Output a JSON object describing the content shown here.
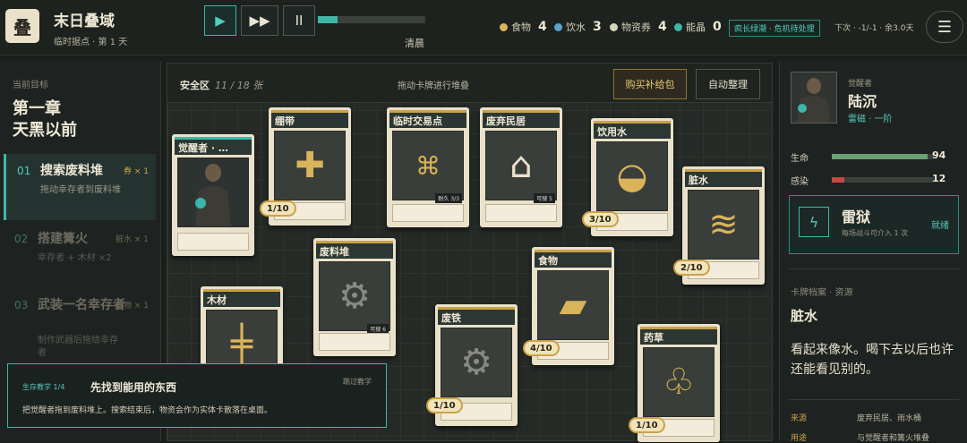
{
  "header": {
    "logo_glyph": "叠",
    "title": "末日叠域",
    "subtitle": "临时据点 · 第 1 天",
    "controls": {
      "play": "▶",
      "fast": "▶▶",
      "pause": "II"
    },
    "time_progress": 0.18,
    "time_of_day": "清晨",
    "resources": [
      {
        "label": "食物",
        "value": "4",
        "color": "#d9b45a"
      },
      {
        "label": "饮水",
        "value": "3",
        "color": "#5aa3c9"
      },
      {
        "label": "物资券",
        "value": "4",
        "color": "#d8d2c0"
      },
      {
        "label": "能晶",
        "value": "0",
        "color": "#3fb7a6"
      }
    ],
    "alert": "疯长绿潮 · 危机待处理",
    "next_event": "下次 · -1/-1 · 余3.0天",
    "menu_icon": "☰"
  },
  "left": {
    "heading": "当前目标",
    "chapter_line1": "第一章",
    "chapter_line2": "天黑以前",
    "tasks": [
      {
        "num": "01",
        "name": "搜索废料堆",
        "desc": "拖动幸存者到废料堆",
        "req": "券 × 1"
      },
      {
        "num": "02",
        "name": "搭建篝火",
        "desc": "幸存者 + 木材 ×2",
        "req": "脏水 × 1"
      },
      {
        "num": "03",
        "name": "武装一名幸存者",
        "desc": "制作武器后拖给幸存者",
        "req": "食物 × 1"
      }
    ]
  },
  "board": {
    "zone": "安全区",
    "count": "11 / 18 张",
    "hint": "拖动卡牌进行堆叠",
    "buy_label": "购买补给包",
    "sort_label": "自动整理",
    "cards": {
      "survivor": {
        "title": "觉醒者 · …"
      },
      "bandage": {
        "title": "绷带",
        "badge": "1/10",
        "icon": "✚"
      },
      "trade": {
        "title": "临时交易点",
        "icon": "⌘",
        "tag": "耐久 3/3"
      },
      "house": {
        "title": "废弃民居",
        "icon": "⌂",
        "tag": "可搜 5"
      },
      "water": {
        "title": "饮用水",
        "badge": "3/10",
        "icon": "◒"
      },
      "dirty": {
        "title": "脏水",
        "badge": "2/10",
        "icon": "≋"
      },
      "scrap": {
        "title": "废料堆",
        "icon": "⚙",
        "tag": "可搜 6"
      },
      "wood": {
        "title": "木材",
        "badge": "1/10",
        "icon": "╪"
      },
      "food": {
        "title": "食物",
        "badge": "4/10",
        "icon": "▰"
      },
      "iron": {
        "title": "废铁",
        "badge": "1/10",
        "icon": "⚙"
      },
      "herb": {
        "title": "药草",
        "badge": "1/10",
        "icon": "♧"
      }
    }
  },
  "tutorial": {
    "label": "生存教学 1/4",
    "title": "先找到能用的东西",
    "skip": "跳过教学",
    "desc": "把觉醒者拖到废料堆上。搜索结束后，物资会作为实体卡散落在桌面。"
  },
  "right": {
    "role": "觉醒者",
    "name": "陆沉",
    "class": "雷磁 · 一阶",
    "hp_label": "生命",
    "hp_value": "94",
    "hp_fraction": 0.94,
    "inf_label": "感染",
    "inf_value": "12",
    "inf_fraction": 0.12,
    "skill_icon": "ϟ",
    "skill_name": "雷狱",
    "skill_desc": "每场战斗可介入 1 次",
    "skill_ready": "就绪",
    "archive_heading": "卡牌档案 · 资源",
    "archive_title": "脏水",
    "archive_desc": "看起来像水。喝下去以后也许还能看见别的。",
    "source_label": "来源",
    "source_value": "废弃民居、雨水桶",
    "use_label": "用途",
    "use_value": "与觉醒者和篝火堆叠"
  }
}
